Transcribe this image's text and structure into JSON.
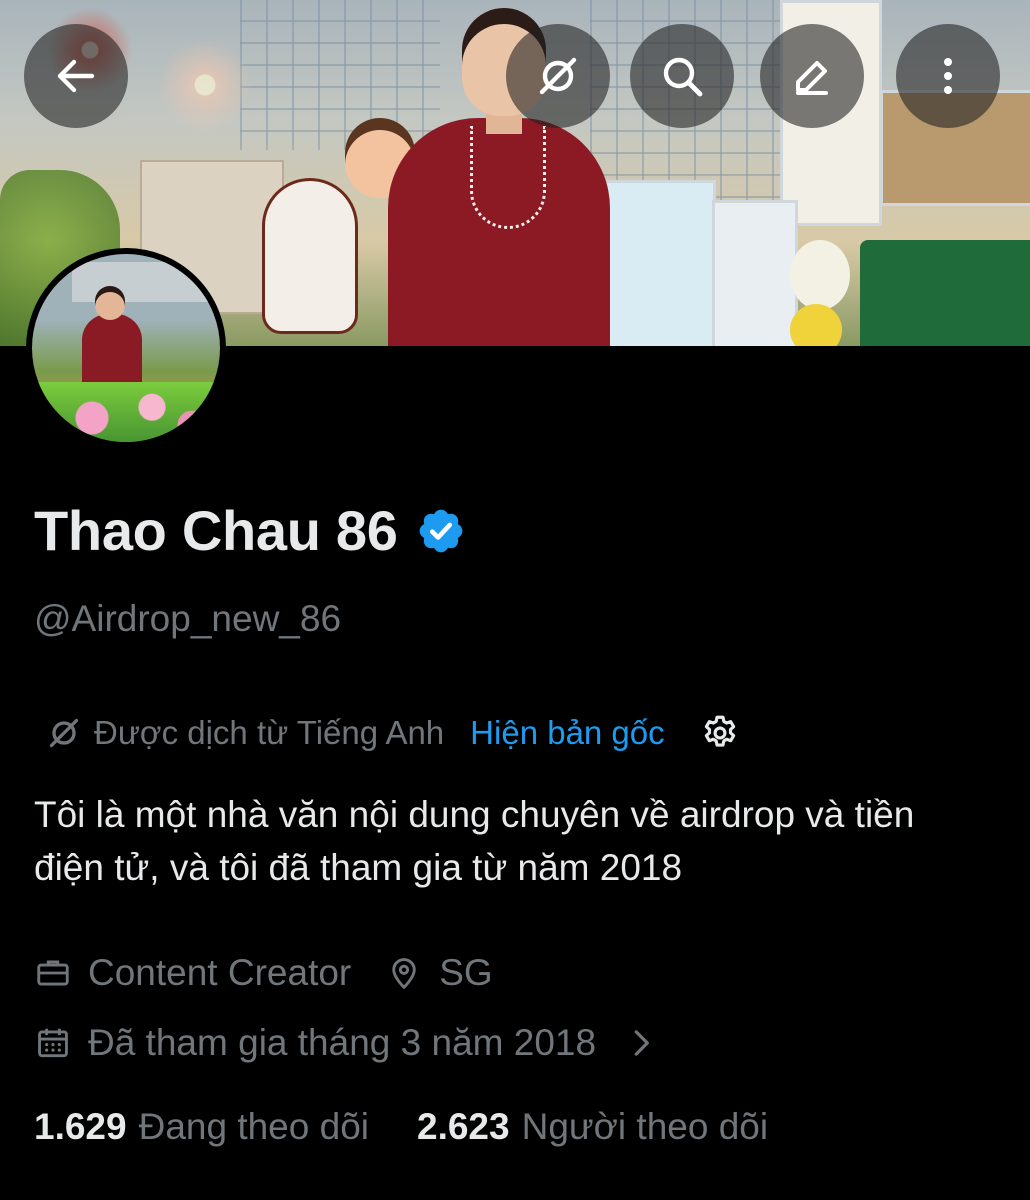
{
  "header": {
    "back_icon": "arrow-left-icon",
    "buttons": [
      "translate-off-icon",
      "search-icon",
      "edit-icon",
      "more-vertical-icon"
    ]
  },
  "profile": {
    "display_name": "Thao Chau 86",
    "verified": true,
    "handle": "@Airdrop_new_86",
    "translation": {
      "note": "Được dịch từ Tiếng Anh",
      "show_original": "Hiện bản gốc"
    },
    "bio": "Tôi là một nhà văn nội dung chuyên về airdrop và tiền điện tử, và tôi đã tham gia từ năm 2018",
    "profession": "Content Creator",
    "location": "SG",
    "joined": "Đã tham gia tháng 3 năm 2018",
    "following_count": "1.629",
    "following_label": "Đang theo dõi",
    "followers_count": "2.623",
    "followers_label": "Người theo dõi"
  },
  "colors": {
    "background": "#000000",
    "text_primary": "#e7e9ea",
    "text_secondary": "#71767b",
    "link": "#1d9bf0",
    "verified_badge": "#1d9bf0"
  }
}
